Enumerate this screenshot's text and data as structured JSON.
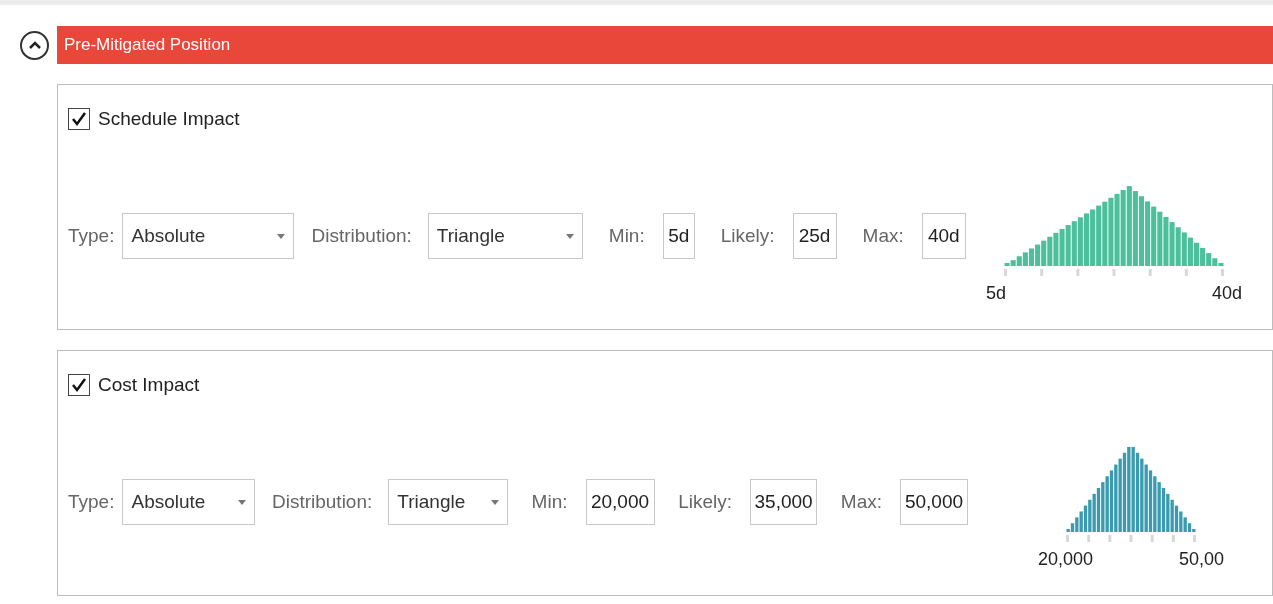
{
  "section": {
    "title": "Pre-Mitigated Position",
    "expanded": true
  },
  "impacts": [
    {
      "label": "Schedule Impact",
      "checked": true,
      "type_label": "Type:",
      "type": "Absolute",
      "distribution_label": "Distribution:",
      "distribution": "Triangle",
      "min_label": "Min:",
      "min": "5d",
      "likely_label": "Likely:",
      "likely": "25d",
      "max_label": "Max:",
      "max": "40d",
      "color": "#4cc09a",
      "axis_min": "5d",
      "axis_max": "40d"
    },
    {
      "label": "Cost Impact",
      "checked": true,
      "type_label": "Type:",
      "type": "Absolute",
      "distribution_label": "Distribution:",
      "distribution": "Triangle",
      "min_label": "Min:",
      "min": "20,000",
      "likely_label": "Likely:",
      "likely": "35,000",
      "max_label": "Max:",
      "max": "50,000",
      "color": "#3a9bb0",
      "axis_min": "20,000",
      "axis_max": "50,00"
    }
  ]
}
